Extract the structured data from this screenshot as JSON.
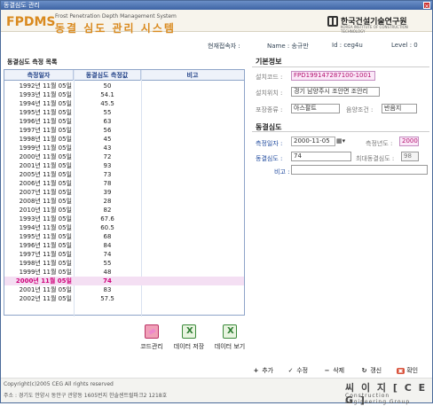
{
  "window": {
    "title": "동결심도 관리"
  },
  "banner": {
    "logo": "FPDMS",
    "subtitle": "Frost Penetration Depth Management System",
    "title": "동결 심도 관리 시스템",
    "org_name": "한국건설기술연구원",
    "org_sub": "KOREA INSTITUTE OF CONSTRUCTION TECHNOLOGY"
  },
  "user": {
    "label": "현재접속자 :",
    "name": "Name : 송규만",
    "id": "Id : ceg4u",
    "level": "Level : 0"
  },
  "list": {
    "title": "동결심도 측정 목록",
    "columns": [
      "측정일자",
      "동결심도 측정값",
      "비고"
    ],
    "rows": [
      {
        "date": "1992년 11월 05일",
        "depth": "50",
        "note": ""
      },
      {
        "date": "1993년 11월 05일",
        "depth": "54.1",
        "note": ""
      },
      {
        "date": "1994년 11월 05일",
        "depth": "45.5",
        "note": ""
      },
      {
        "date": "1995년 11월 05일",
        "depth": "55",
        "note": ""
      },
      {
        "date": "1996년 11월 05일",
        "depth": "63",
        "note": ""
      },
      {
        "date": "1997년 11월 05일",
        "depth": "56",
        "note": ""
      },
      {
        "date": "1998년 11월 05일",
        "depth": "45",
        "note": ""
      },
      {
        "date": "1999년 11월 05일",
        "depth": "43",
        "note": ""
      },
      {
        "date": "2000년 11월 05일",
        "depth": "72",
        "note": ""
      },
      {
        "date": "2001년 11월 05일",
        "depth": "93",
        "note": ""
      },
      {
        "date": "2005년 11월 05일",
        "depth": "73",
        "note": ""
      },
      {
        "date": "2006년 11월 05일",
        "depth": "78",
        "note": ""
      },
      {
        "date": "2007년 11월 05일",
        "depth": "39",
        "note": ""
      },
      {
        "date": "2008년 11월 05일",
        "depth": "28",
        "note": ""
      },
      {
        "date": "2010년 11월 05일",
        "depth": "82",
        "note": ""
      },
      {
        "date": "1993년 11월 05일",
        "depth": "67.6",
        "note": ""
      },
      {
        "date": "1994년 11월 05일",
        "depth": "60.5",
        "note": ""
      },
      {
        "date": "1995년 11월 05일",
        "depth": "68",
        "note": ""
      },
      {
        "date": "1996년 11월 05일",
        "depth": "84",
        "note": ""
      },
      {
        "date": "1997년 11월 05일",
        "depth": "74",
        "note": ""
      },
      {
        "date": "1998년 11월 05일",
        "depth": "55",
        "note": ""
      },
      {
        "date": "1999년 11월 05일",
        "depth": "48",
        "note": ""
      },
      {
        "date": "2000년 11월 05일",
        "depth": "74",
        "note": "",
        "selected": true
      },
      {
        "date": "2001년 11월 05일",
        "depth": "83",
        "note": ""
      },
      {
        "date": "2002년 11월 05일",
        "depth": "57.5",
        "note": ""
      }
    ]
  },
  "tools": {
    "code": "코드관리",
    "save": "데이터 저장",
    "view": "데이터 보기"
  },
  "basic": {
    "title": "기본정보",
    "code_label": "설치코드 :",
    "code_value": "FPD199147287100-1001",
    "location_label": "설치위치 :",
    "location_value": "경기 남양주시 조안면 조안리",
    "pavement_label": "포장종류 :",
    "pavement_value": "아스팔트",
    "condition_label": "음양조건 :",
    "condition_value": "반음지"
  },
  "frost": {
    "title": "동결심도",
    "date_label": "측정일자 :",
    "date_value": "2000-11-05",
    "year_label": "측정년도 :",
    "year_value": "2000",
    "depth_label": "동결심도 :",
    "depth_value": "74",
    "max_label": "최대동결심도 :",
    "max_value": "98",
    "note_label": "비고 :",
    "note_value": ""
  },
  "actions": {
    "add": "추가",
    "edit": "수정",
    "delete": "삭제",
    "refresh": "갱신",
    "confirm": "확인"
  },
  "footer": {
    "copyright": "Copyright(c)2005 CEG All rights reserved",
    "address": "주소 : 경기도 안양시 동안구 관양동 1605번지 한솔센트럴파크2 1218호",
    "brand": "씨 이 지 [ C E G ]",
    "brand_sub": "Construction Engineering Group"
  }
}
